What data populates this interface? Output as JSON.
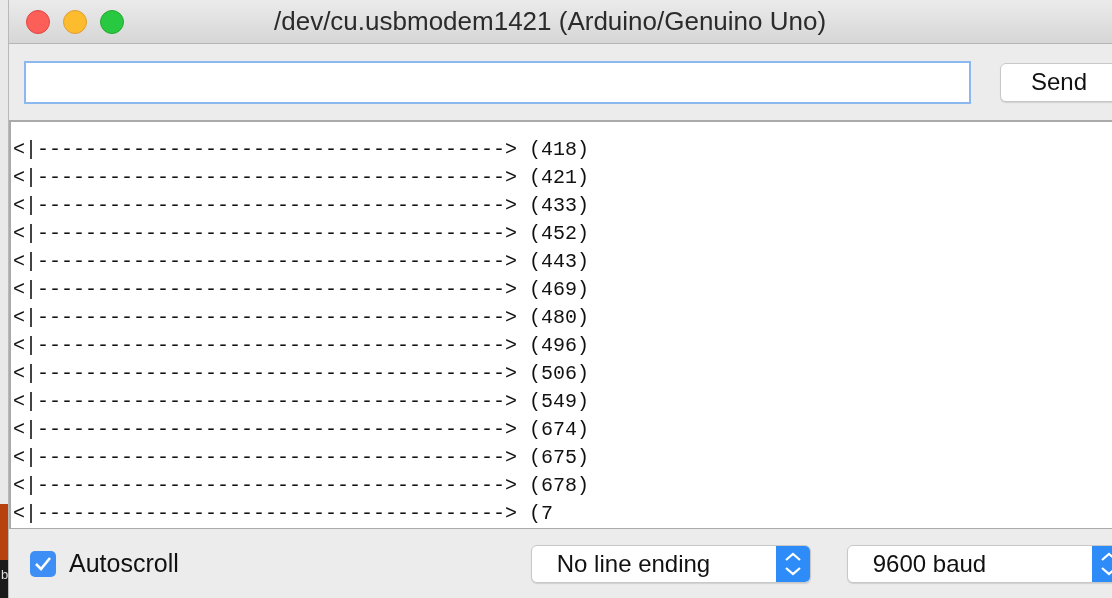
{
  "desktop_fragment": "b",
  "window": {
    "title": "/dev/cu.usbmodem1421 (Arduino/Genuino Uno)"
  },
  "send_button": "Send",
  "output_lines": [
    "<|---------------------------------------> (418)",
    "<|---------------------------------------> (421)",
    "<|---------------------------------------> (433)",
    "<|---------------------------------------> (452)",
    "<|---------------------------------------> (443)",
    "<|---------------------------------------> (469)",
    "<|---------------------------------------> (480)",
    "<|---------------------------------------> (496)",
    "<|---------------------------------------> (506)",
    "<|---------------------------------------> (549)",
    "<|---------------------------------------> (674)",
    "<|---------------------------------------> (675)",
    "<|---------------------------------------> (678)",
    "<|---------------------------------------> (7"
  ],
  "autoscroll": {
    "label": "Autoscroll",
    "checked": true
  },
  "line_ending": {
    "value": "No line ending"
  },
  "baud_rate": {
    "value": "9600 baud"
  }
}
